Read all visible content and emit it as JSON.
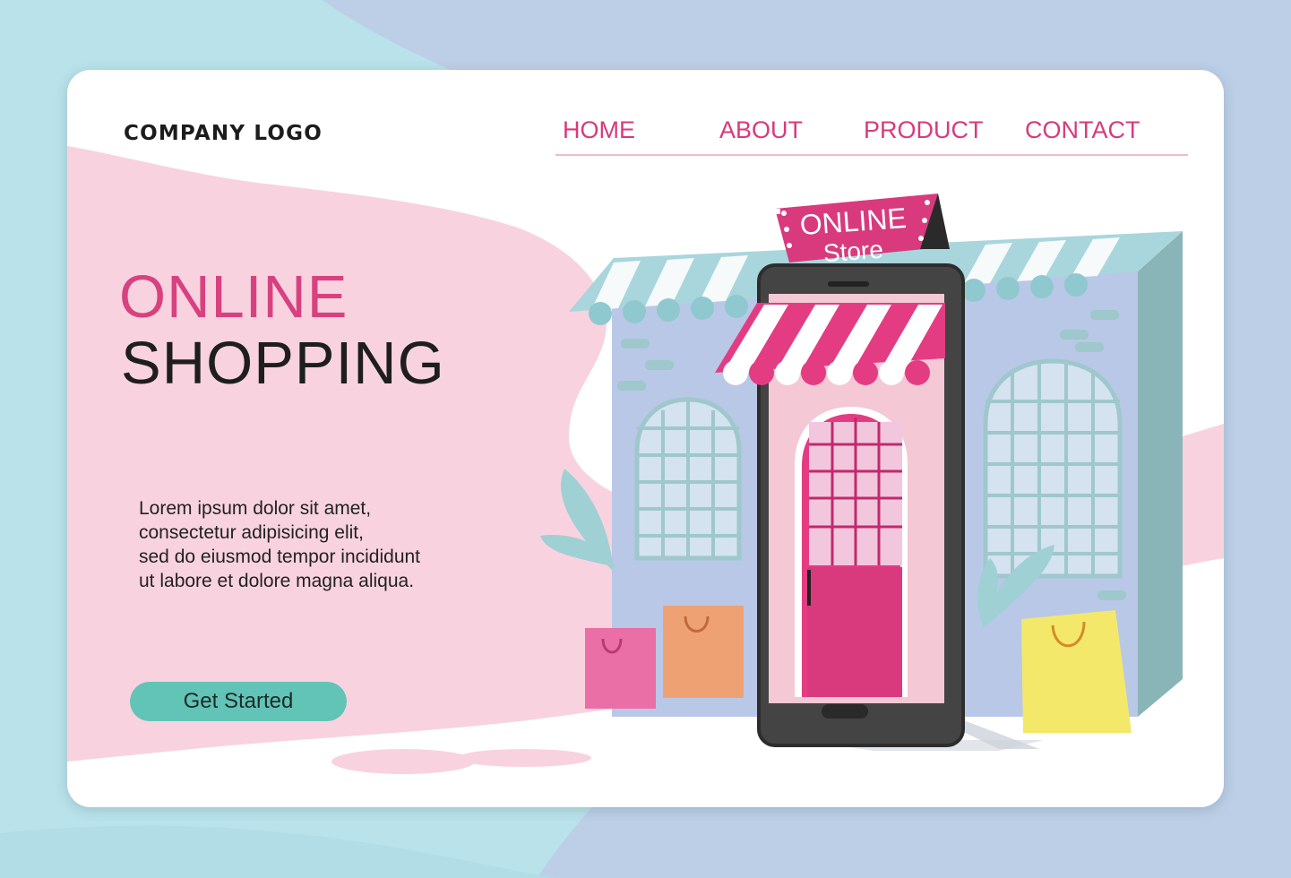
{
  "brand": {
    "logo_text": "COMPANY LOGO"
  },
  "nav": {
    "items": [
      {
        "label": "HOME"
      },
      {
        "label": "ABOUT"
      },
      {
        "label": "PRODUCT"
      },
      {
        "label": "CONTACT"
      }
    ]
  },
  "hero": {
    "title_line1": "ONLINE",
    "title_line2": "SHOPPING",
    "body_lines": [
      "Lorem ipsum dolor sit amet,",
      "consectetur adipisicing elit,",
      "sed do eiusmod tempor incididunt",
      "ut labore et dolore magna aliqua."
    ],
    "cta_label": "Get Started"
  },
  "illustration": {
    "sign_line1": "ONLINE",
    "sign_line2": "Store"
  },
  "colors": {
    "accent_pink": "#d8417f",
    "teal_button": "#62c4b6",
    "blob_pink": "#f8d3df",
    "page_bg_blue": "#b9e2ea"
  }
}
